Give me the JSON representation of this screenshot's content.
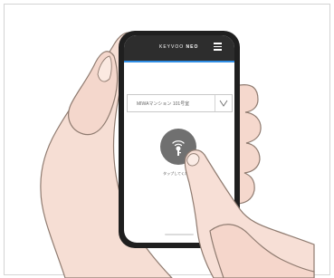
{
  "app": {
    "brand_prefix": "KEYVOO",
    "brand_suffix": "NEO"
  },
  "header": {
    "menu_icon": "hamburger-menu-icon"
  },
  "selector": {
    "value": "MIWAマンション 101号室",
    "arrow_icon": "chevron-down-icon"
  },
  "unlock": {
    "icon": "key-wireless-icon",
    "label": "タップしてください"
  },
  "colors": {
    "accent": "#2f8de4",
    "header": "#2d2d2d",
    "button": "#707070"
  }
}
